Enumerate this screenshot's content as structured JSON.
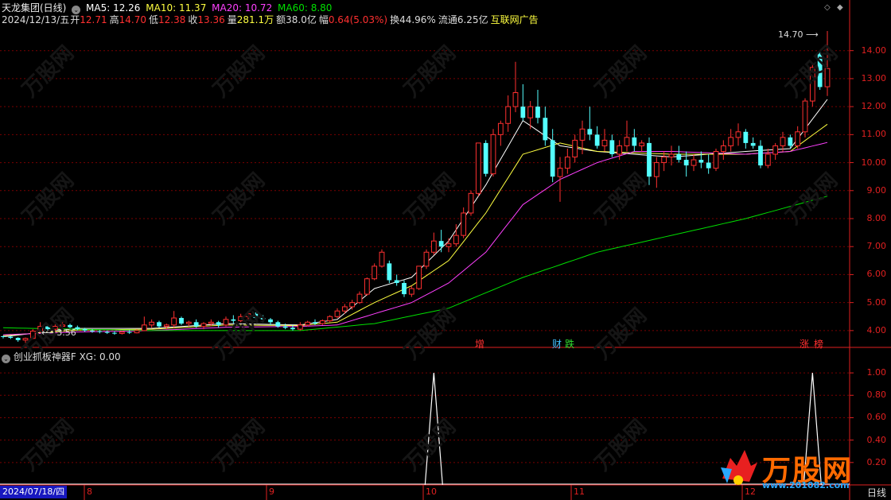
{
  "header": {
    "stock": "天龙集团(日线)",
    "ma5": "MA5: 12.26",
    "ma10": "MA10: 11.37",
    "ma20": "MA20: 10.72",
    "ma60": "MA60: 8.80",
    "date": "2024/12/13/五",
    "open_label": "开",
    "open": "12.71",
    "high_label": "高",
    "high": "14.70",
    "low_label": "低",
    "low": "12.38",
    "close_label": "收",
    "close": "13.36",
    "vol_label": "量",
    "vol": "281.1万",
    "amt_label": "额",
    "amt": "38.0亿",
    "chg_label": "幅",
    "chg": "0.64(5.03%)",
    "turn_label": "换",
    "turn": "44.96%",
    "float_label": "流通",
    "float": "6.25亿",
    "ad": "互联网广告"
  },
  "indicator": {
    "name": "创业抓板神器F",
    "xg": "XG: 0.00"
  },
  "price_axis": [
    "14.00",
    "13.00",
    "12.00",
    "11.00",
    "10.00",
    "9.00",
    "8.00",
    "7.00",
    "6.00",
    "5.00",
    "4.00"
  ],
  "ind_axis": [
    "1.00",
    "0.80",
    "0.60",
    "0.40",
    "0.20"
  ],
  "x_axis": {
    "cursor_date": "2024/07/18/四",
    "months": [
      "8",
      "9",
      "10",
      "11",
      "12"
    ],
    "period": "日线"
  },
  "annotations": {
    "high_mark": "14.70",
    "low_mark": "3.56"
  },
  "events": [
    {
      "label": "增",
      "color": "#ff3030"
    },
    {
      "label": "财",
      "color": "#40c0ff"
    },
    {
      "label": "跌",
      "color": "#30e030"
    },
    {
      "label": "涨",
      "color": "#ff3030"
    },
    {
      "label": "榜",
      "color": "#ff3030"
    }
  ],
  "watermark": "万股网",
  "logo": {
    "text": "万股网",
    "url": "www.201082.com"
  },
  "colors": {
    "up": "#ff3030",
    "down": "#54ffff",
    "ma5": "#ffffff",
    "ma10": "#ffff40",
    "ma20": "#ff40ff",
    "ma60": "#00e000",
    "grid": "#7a0000",
    "axis": "#e02020"
  },
  "chart_data": {
    "type": "candlestick",
    "price_range": [
      3.4,
      14.9
    ],
    "candles": [
      [
        3.8,
        3.82,
        3.72,
        3.78
      ],
      [
        3.78,
        3.8,
        3.7,
        3.74
      ],
      [
        3.74,
        3.76,
        3.6,
        3.66
      ],
      [
        3.66,
        3.75,
        3.56,
        3.72
      ],
      [
        3.72,
        4.05,
        3.7,
        3.98
      ],
      [
        3.98,
        4.3,
        3.92,
        4.15
      ],
      [
        4.15,
        4.2,
        4.0,
        4.05
      ],
      [
        4.05,
        4.22,
        3.98,
        4.15
      ],
      [
        4.15,
        4.35,
        4.1,
        4.2
      ],
      [
        4.2,
        4.25,
        4.08,
        4.12
      ],
      [
        4.12,
        4.18,
        4.0,
        4.05
      ],
      [
        4.05,
        4.1,
        3.95,
        4.0
      ],
      [
        4.0,
        4.05,
        3.92,
        3.98
      ],
      [
        3.98,
        4.02,
        3.9,
        3.95
      ],
      [
        3.95,
        4.0,
        3.88,
        3.92
      ],
      [
        3.92,
        3.98,
        3.85,
        3.9
      ],
      [
        3.9,
        4.0,
        3.86,
        3.95
      ],
      [
        3.95,
        4.02,
        3.88,
        3.92
      ],
      [
        3.92,
        4.05,
        3.9,
        4.0
      ],
      [
        4.0,
        4.5,
        3.98,
        4.2
      ],
      [
        4.2,
        4.4,
        4.1,
        4.3
      ],
      [
        4.3,
        4.35,
        4.1,
        4.15
      ],
      [
        4.15,
        4.25,
        4.05,
        4.2
      ],
      [
        4.2,
        4.7,
        4.1,
        4.45
      ],
      [
        4.45,
        4.5,
        4.2,
        4.25
      ],
      [
        4.25,
        4.35,
        4.15,
        4.3
      ],
      [
        4.3,
        4.4,
        4.1,
        4.15
      ],
      [
        4.15,
        4.3,
        4.05,
        4.25
      ],
      [
        4.25,
        4.4,
        4.15,
        4.3
      ],
      [
        4.3,
        4.35,
        4.1,
        4.2
      ],
      [
        4.2,
        4.5,
        4.15,
        4.4
      ],
      [
        4.4,
        4.55,
        4.25,
        4.35
      ],
      [
        4.35,
        4.6,
        4.3,
        4.5
      ],
      [
        4.5,
        4.7,
        4.4,
        4.6
      ],
      [
        4.6,
        4.65,
        4.4,
        4.45
      ],
      [
        4.45,
        4.55,
        4.3,
        4.4
      ],
      [
        4.4,
        4.45,
        4.2,
        4.3
      ],
      [
        4.3,
        4.35,
        4.1,
        4.15
      ],
      [
        4.15,
        4.25,
        4.05,
        4.1
      ],
      [
        4.1,
        4.2,
        4.0,
        4.05
      ],
      [
        4.05,
        4.3,
        4.0,
        4.2
      ],
      [
        4.2,
        4.35,
        4.15,
        4.3
      ],
      [
        4.3,
        4.4,
        4.2,
        4.25
      ],
      [
        4.25,
        4.4,
        4.2,
        4.35
      ],
      [
        4.35,
        4.55,
        4.3,
        4.5
      ],
      [
        4.5,
        4.8,
        4.45,
        4.7
      ],
      [
        4.7,
        4.95,
        4.6,
        4.85
      ],
      [
        4.85,
        5.1,
        4.75,
        5.0
      ],
      [
        5.0,
        5.4,
        4.95,
        5.3
      ],
      [
        5.3,
        5.9,
        5.25,
        5.85
      ],
      [
        5.85,
        6.4,
        5.8,
        6.3
      ],
      [
        6.3,
        6.9,
        6.25,
        6.8
      ],
      [
        6.4,
        6.5,
        5.7,
        5.8
      ],
      [
        5.8,
        6.0,
        5.6,
        5.7
      ],
      [
        5.7,
        5.8,
        5.2,
        5.3
      ],
      [
        5.3,
        5.6,
        5.2,
        5.5
      ],
      [
        5.5,
        6.3,
        5.45,
        6.3
      ],
      [
        6.3,
        6.9,
        6.2,
        6.8
      ],
      [
        6.8,
        7.5,
        6.7,
        7.2
      ],
      [
        7.2,
        7.6,
        6.8,
        7.0
      ],
      [
        7.0,
        7.3,
        6.8,
        7.1
      ],
      [
        7.1,
        7.8,
        7.0,
        7.4
      ],
      [
        7.4,
        8.4,
        7.3,
        8.2
      ],
      [
        8.2,
        9.0,
        8.1,
        8.9
      ],
      [
        8.9,
        10.7,
        8.8,
        10.7
      ],
      [
        10.7,
        10.8,
        9.5,
        9.6
      ],
      [
        9.6,
        11.2,
        9.5,
        11.0
      ],
      [
        11.0,
        11.5,
        10.6,
        11.4
      ],
      [
        11.4,
        12.4,
        11.1,
        12.0
      ],
      [
        12.0,
        13.6,
        11.8,
        12.5
      ],
      [
        12.0,
        12.8,
        11.5,
        11.6
      ],
      [
        11.6,
        12.2,
        11.2,
        12.0
      ],
      [
        12.0,
        12.6,
        11.4,
        11.6
      ],
      [
        11.6,
        12.0,
        10.6,
        10.8
      ],
      [
        10.8,
        11.2,
        9.3,
        9.5
      ],
      [
        9.5,
        10.2,
        8.6,
        9.8
      ],
      [
        9.8,
        10.5,
        9.6,
        10.2
      ],
      [
        10.2,
        11.0,
        10.0,
        10.8
      ],
      [
        10.8,
        11.5,
        10.3,
        11.2
      ],
      [
        11.2,
        12.0,
        10.8,
        11.0
      ],
      [
        11.0,
        11.3,
        10.5,
        10.6
      ],
      [
        10.6,
        11.2,
        10.4,
        10.8
      ],
      [
        10.8,
        11.0,
        10.2,
        10.3
      ],
      [
        10.3,
        10.8,
        10.1,
        10.6
      ],
      [
        10.6,
        11.5,
        10.4,
        10.9
      ],
      [
        10.9,
        11.2,
        10.4,
        10.6
      ],
      [
        10.6,
        10.8,
        10.4,
        10.7
      ],
      [
        10.7,
        10.9,
        9.2,
        9.5
      ],
      [
        9.5,
        10.2,
        9.1,
        10.0
      ],
      [
        10.0,
        10.4,
        9.7,
        10.2
      ],
      [
        10.2,
        10.6,
        9.9,
        10.3
      ],
      [
        10.3,
        10.6,
        10.0,
        10.1
      ],
      [
        10.1,
        10.4,
        9.5,
        9.9
      ],
      [
        9.9,
        10.3,
        9.7,
        10.1
      ],
      [
        10.1,
        10.4,
        9.8,
        10.0
      ],
      [
        10.0,
        10.3,
        9.6,
        9.8
      ],
      [
        9.8,
        10.5,
        9.7,
        10.4
      ],
      [
        10.4,
        10.8,
        10.1,
        10.6
      ],
      [
        10.6,
        11.2,
        10.4,
        10.9
      ],
      [
        10.9,
        11.4,
        10.6,
        11.1
      ],
      [
        11.1,
        11.2,
        10.5,
        10.7
      ],
      [
        10.7,
        10.9,
        10.5,
        10.6
      ],
      [
        10.6,
        10.8,
        9.8,
        9.9
      ],
      [
        9.9,
        10.5,
        9.8,
        10.3
      ],
      [
        10.3,
        10.7,
        10.1,
        10.6
      ],
      [
        10.6,
        11.1,
        10.4,
        10.9
      ],
      [
        10.9,
        11.0,
        10.5,
        10.6
      ],
      [
        10.6,
        11.3,
        10.5,
        11.1
      ],
      [
        11.1,
        12.3,
        10.9,
        12.2
      ],
      [
        12.2,
        13.5,
        12.0,
        13.4
      ],
      [
        13.9,
        14.0,
        12.6,
        12.7
      ],
      [
        12.71,
        14.7,
        12.38,
        13.36
      ]
    ],
    "ma": [
      {
        "name": "MA5",
        "color": "#ffffff",
        "anchors": [
          [
            0,
            3.78
          ],
          [
            10,
            4.08
          ],
          [
            20,
            4.08
          ],
          [
            30,
            4.25
          ],
          [
            40,
            4.2
          ],
          [
            45,
            4.4
          ],
          [
            50,
            5.5
          ],
          [
            55,
            5.9
          ],
          [
            60,
            7.2
          ],
          [
            65,
            9.2
          ],
          [
            70,
            11.5
          ],
          [
            75,
            10.6
          ],
          [
            80,
            10.4
          ],
          [
            90,
            10.2
          ],
          [
            100,
            10.4
          ],
          [
            106,
            10.5
          ],
          [
            111,
            12.26
          ]
        ]
      },
      {
        "name": "MA10",
        "color": "#ffff40",
        "anchors": [
          [
            0,
            3.82
          ],
          [
            10,
            4.02
          ],
          [
            20,
            4.05
          ],
          [
            30,
            4.2
          ],
          [
            40,
            4.18
          ],
          [
            45,
            4.3
          ],
          [
            50,
            5.0
          ],
          [
            55,
            5.6
          ],
          [
            60,
            6.5
          ],
          [
            65,
            8.2
          ],
          [
            70,
            10.3
          ],
          [
            75,
            10.7
          ],
          [
            80,
            10.4
          ],
          [
            90,
            10.3
          ],
          [
            100,
            10.3
          ],
          [
            106,
            10.4
          ],
          [
            111,
            11.37
          ]
        ]
      },
      {
        "name": "MA20",
        "color": "#ff40ff",
        "anchors": [
          [
            0,
            3.85
          ],
          [
            10,
            3.95
          ],
          [
            20,
            4.0
          ],
          [
            30,
            4.12
          ],
          [
            40,
            4.15
          ],
          [
            45,
            4.2
          ],
          [
            50,
            4.6
          ],
          [
            55,
            5.0
          ],
          [
            60,
            5.7
          ],
          [
            65,
            6.8
          ],
          [
            70,
            8.5
          ],
          [
            75,
            9.4
          ],
          [
            80,
            10.0
          ],
          [
            85,
            10.4
          ],
          [
            90,
            10.4
          ],
          [
            100,
            10.3
          ],
          [
            106,
            10.4
          ],
          [
            111,
            10.72
          ]
        ]
      },
      {
        "name": "MA60",
        "color": "#00e000",
        "anchors": [
          [
            0,
            4.1
          ],
          [
            20,
            4.0
          ],
          [
            40,
            4.0
          ],
          [
            50,
            4.25
          ],
          [
            60,
            4.8
          ],
          [
            70,
            5.9
          ],
          [
            80,
            6.8
          ],
          [
            90,
            7.4
          ],
          [
            100,
            8.0
          ],
          [
            111,
            8.8
          ]
        ]
      }
    ],
    "indicator_series": {
      "name": "XG",
      "range": [
        0,
        1.1
      ],
      "spikes": [
        58,
        109
      ]
    }
  }
}
